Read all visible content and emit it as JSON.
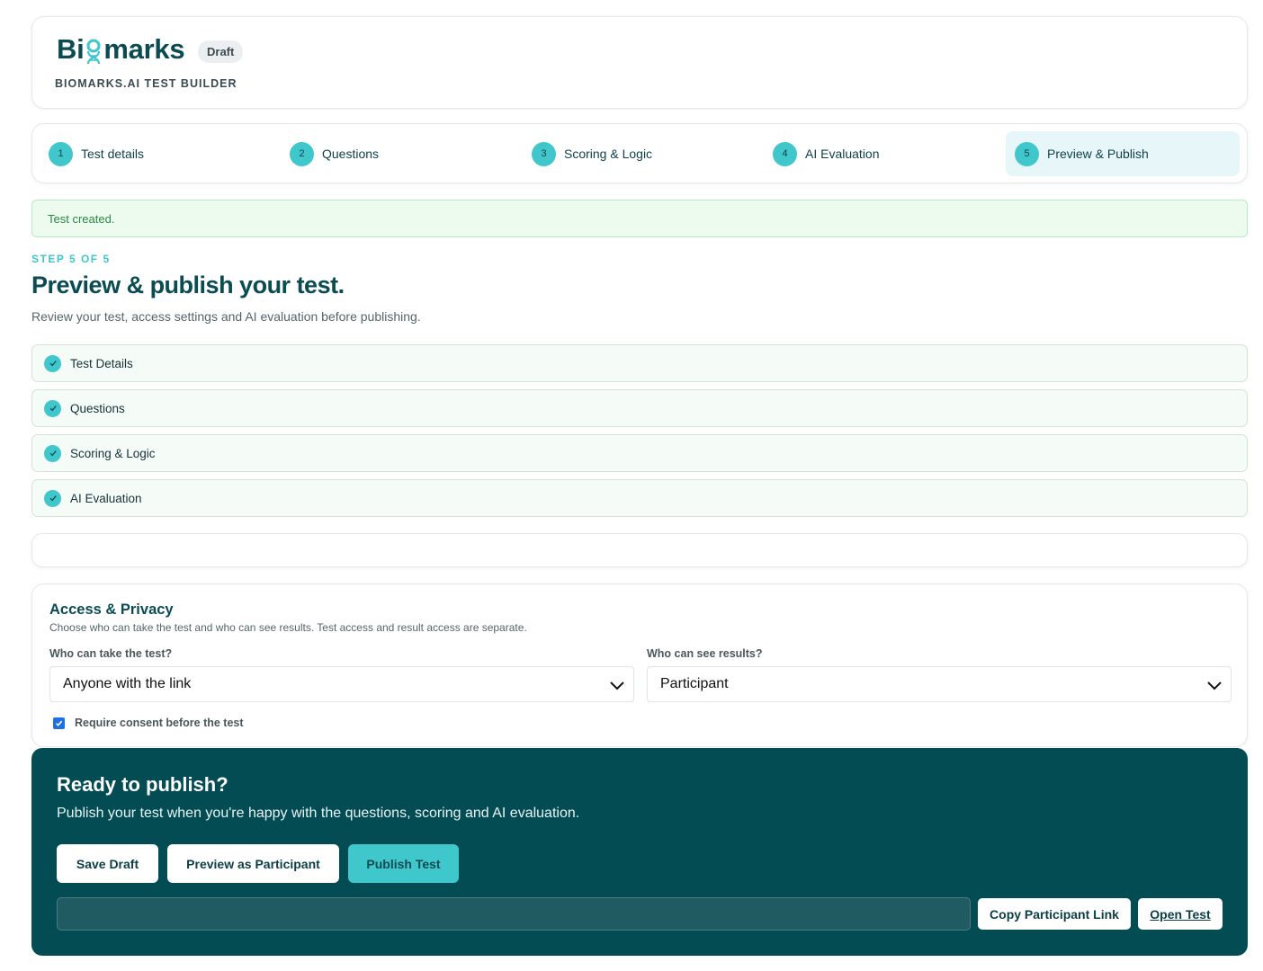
{
  "header": {
    "logo_prefix": "Bi",
    "logo_suffix": "marks",
    "badge": "Draft",
    "subtitle": "BIOMARKS.AI TEST BUILDER"
  },
  "steps": [
    {
      "num": "1",
      "label": "Test details"
    },
    {
      "num": "2",
      "label": "Questions"
    },
    {
      "num": "3",
      "label": "Scoring & Logic"
    },
    {
      "num": "4",
      "label": "AI Evaluation"
    },
    {
      "num": "5",
      "label": "Preview & Publish",
      "active": true
    }
  ],
  "alert": "Test created.",
  "page": {
    "eyebrow": "STEP 5 OF 5",
    "title": "Preview & publish your test.",
    "description": "Review your test, access settings and AI evaluation before publishing."
  },
  "checklist": [
    "Test Details",
    "Questions",
    "Scoring & Logic",
    "AI Evaluation"
  ],
  "access": {
    "title": "Access & Privacy",
    "description": "Choose who can take the test and who can see results. Test access and result access are separate.",
    "take_label": "Who can take the test?",
    "take_value": "Anyone with the link",
    "results_label": "Who can see results?",
    "results_value": "Participant",
    "consent_label": "Require consent before the test",
    "consent_checked": true
  },
  "publish": {
    "title": "Ready to publish?",
    "description": "Publish your test when you're happy with the questions, scoring and AI evaluation.",
    "save_draft": "Save Draft",
    "preview": "Preview as Participant",
    "publish": "Publish Test",
    "copy_link": "Copy Participant Link",
    "open_test": "Open Test"
  },
  "colors": {
    "accent": "#3fc7cc",
    "brand_dark": "#034c54",
    "success_text": "#2a8a43",
    "checkbox": "#1f6fe5"
  }
}
